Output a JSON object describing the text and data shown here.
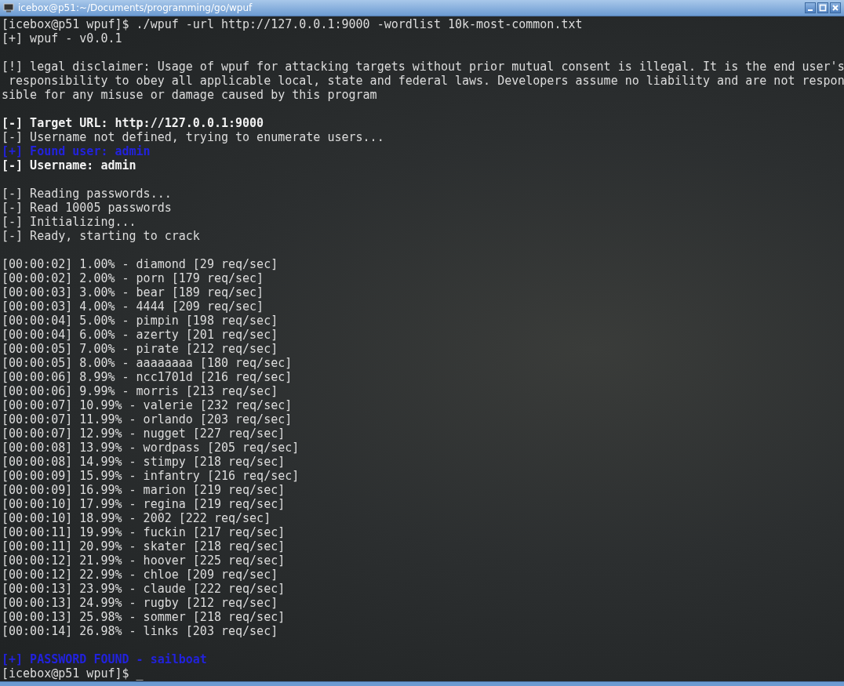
{
  "window": {
    "title": "icebox@p51:~/Documents/programming/go/wpuf"
  },
  "lines": [
    {
      "kind": "normal",
      "text": "[icebox@p51 wpuf]$ ./wpuf -url http://127.0.0.1:9000 -wordlist 10k-most-common.txt"
    },
    {
      "kind": "normal",
      "text": "[+] wpuf - v0.0.1"
    },
    {
      "kind": "blank"
    },
    {
      "kind": "normal",
      "text": "[!] legal disclaimer: Usage of wpuf for attacking targets without prior mutual consent is illegal. It is the end user's"
    },
    {
      "kind": "normal",
      "text": " responsibility to obey all applicable local, state and federal laws. Developers assume no liability and are not respon"
    },
    {
      "kind": "normal",
      "text": "sible for any misuse or damage caused by this program"
    },
    {
      "kind": "blank"
    },
    {
      "kind": "bold",
      "text": "[-] Target URL: http://127.0.0.1:9000"
    },
    {
      "kind": "normal",
      "text": "[-] Username not defined, trying to enumerate users..."
    },
    {
      "kind": "blue",
      "text": "[+] Found user: admin"
    },
    {
      "kind": "bold",
      "text": "[-] Username: admin"
    },
    {
      "kind": "blank"
    },
    {
      "kind": "normal",
      "text": "[-] Reading passwords..."
    },
    {
      "kind": "normal",
      "text": "[-] Read 10005 passwords"
    },
    {
      "kind": "normal",
      "text": "[-] Initializing..."
    },
    {
      "kind": "normal",
      "text": "[-] Ready, starting to crack"
    },
    {
      "kind": "blank"
    },
    {
      "kind": "normal",
      "text": "[00:00:02] 1.00% - diamond [29 req/sec]"
    },
    {
      "kind": "normal",
      "text": "[00:00:02] 2.00% - porn [179 req/sec]"
    },
    {
      "kind": "normal",
      "text": "[00:00:03] 3.00% - bear [189 req/sec]"
    },
    {
      "kind": "normal",
      "text": "[00:00:03] 4.00% - 4444 [209 req/sec]"
    },
    {
      "kind": "normal",
      "text": "[00:00:04] 5.00% - pimpin [198 req/sec]"
    },
    {
      "kind": "normal",
      "text": "[00:00:04] 6.00% - azerty [201 req/sec]"
    },
    {
      "kind": "normal",
      "text": "[00:00:05] 7.00% - pirate [212 req/sec]"
    },
    {
      "kind": "normal",
      "text": "[00:00:05] 8.00% - aaaaaaaa [180 req/sec]"
    },
    {
      "kind": "normal",
      "text": "[00:00:06] 8.99% - ncc1701d [216 req/sec]"
    },
    {
      "kind": "normal",
      "text": "[00:00:06] 9.99% - morris [213 req/sec]"
    },
    {
      "kind": "normal",
      "text": "[00:00:07] 10.99% - valerie [232 req/sec]"
    },
    {
      "kind": "normal",
      "text": "[00:00:07] 11.99% - orlando [203 req/sec]"
    },
    {
      "kind": "normal",
      "text": "[00:00:07] 12.99% - nugget [227 req/sec]"
    },
    {
      "kind": "normal",
      "text": "[00:00:08] 13.99% - wordpass [205 req/sec]"
    },
    {
      "kind": "normal",
      "text": "[00:00:08] 14.99% - stimpy [218 req/sec]"
    },
    {
      "kind": "normal",
      "text": "[00:00:09] 15.99% - infantry [216 req/sec]"
    },
    {
      "kind": "normal",
      "text": "[00:00:09] 16.99% - marion [219 req/sec]"
    },
    {
      "kind": "normal",
      "text": "[00:00:10] 17.99% - regina [219 req/sec]"
    },
    {
      "kind": "normal",
      "text": "[00:00:10] 18.99% - 2002 [222 req/sec]"
    },
    {
      "kind": "normal",
      "text": "[00:00:11] 19.99% - fuckin [217 req/sec]"
    },
    {
      "kind": "normal",
      "text": "[00:00:11] 20.99% - skater [218 req/sec]"
    },
    {
      "kind": "normal",
      "text": "[00:00:12] 21.99% - hoover [225 req/sec]"
    },
    {
      "kind": "normal",
      "text": "[00:00:12] 22.99% - chloe [209 req/sec]"
    },
    {
      "kind": "normal",
      "text": "[00:00:13] 23.99% - claude [222 req/sec]"
    },
    {
      "kind": "normal",
      "text": "[00:00:13] 24.99% - rugby [212 req/sec]"
    },
    {
      "kind": "normal",
      "text": "[00:00:13] 25.98% - sommer [218 req/sec]"
    },
    {
      "kind": "normal",
      "text": "[00:00:14] 26.98% - links [203 req/sec]"
    },
    {
      "kind": "blank"
    },
    {
      "kind": "blue",
      "text": "[+] PASSWORD FOUND - sailboat"
    },
    {
      "kind": "normal",
      "text": "[icebox@p51 wpuf]$ _"
    }
  ]
}
